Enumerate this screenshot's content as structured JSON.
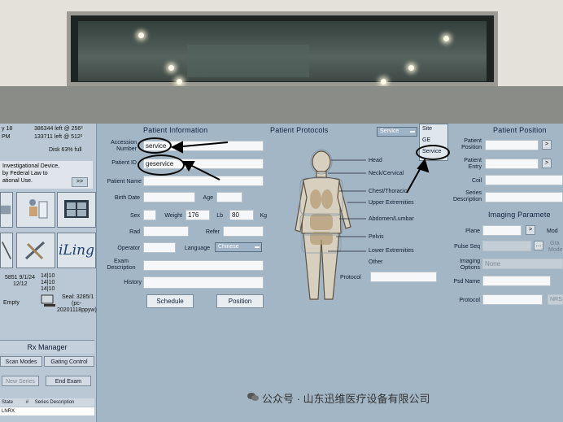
{
  "left_panel": {
    "top_lines": [
      {
        "left": "y 18",
        "right": "386344 left @ 256²"
      },
      {
        "left": "PM",
        "right": "133711 left @ 512²"
      }
    ],
    "disk": "Disk  63% full",
    "investigational": [
      "Investigational Device,",
      "by Federal Law to",
      "ational Use."
    ],
    "inv_button": ">>",
    "tile_caption_left": [
      "5851 9/1/24",
      "12/12"
    ],
    "tile_caption_mid": [
      "14|10",
      "14|10",
      "14|10"
    ],
    "empty_label": "Empty",
    "seal": [
      "Seal: 3285/1",
      "(pc-",
      "20201118ppyw)"
    ],
    "iling": "iLing",
    "rx_manager": "Rx Manager",
    "scan_modes": "Scan Modes",
    "gating_control": "Gating Control",
    "new_series": "New Series",
    "end_exam": "End Exam",
    "table_headers": [
      "State",
      "#",
      "Series Description"
    ],
    "row_1": "LNRX"
  },
  "patient_info": {
    "title": "Patient  Information",
    "accession_label": "Accession\nNumber",
    "accession_value": "service",
    "patient_id_label": "Patient ID",
    "patient_id_value": "geservice",
    "patient_name_label": "Patient Name",
    "birth_date_label": "Birth Date",
    "age_label": "Age",
    "sex_label": "Sex",
    "weight_label": "Weight",
    "weight_lb": "176",
    "lb_label": "Lb",
    "weight_kg": "80",
    "kg_label": "Kg",
    "rad_label": "Rad",
    "refer_label": "Refer",
    "operator_label": "Operator",
    "language_label": "Language",
    "language_value": "Chinese",
    "exam_desc_label": "Exam\nDescription",
    "history_label": "History",
    "schedule_button": "Schedule",
    "position_button": "Position"
  },
  "protocols": {
    "title": "Patient  Protocols",
    "selected": "Service",
    "menu": [
      "Site",
      "GE",
      "Service"
    ],
    "body_parts": [
      "Head",
      "Neck/Cervical",
      "Chest/Thoracic",
      "Upper Extremities",
      "Abdomen/Lumbar",
      "Pelvis",
      "Lower Extremities",
      "Other"
    ],
    "protocol_label": "Protocol"
  },
  "position": {
    "title": "Patient  Position",
    "patient_position_label": "Patient\nPosition",
    "patient_entry_label": "Patient\nEntry",
    "coil_label": "Coil",
    "series_desc_label": "Series\nDescription"
  },
  "imaging": {
    "title": "Imaging  Paramete",
    "plane_label": "Plane",
    "mode_label": "Mod",
    "pulse_seq_label": "Pulse Seq",
    "gra_label": "Gra",
    "mode2_label": "Mode",
    "imaging_options_label": "Imaging\nOptions",
    "imaging_options_value": "None",
    "psd_name_label": "Psd Name",
    "protocol_label": "Protocol",
    "nrs_label": "NRS"
  },
  "watermark": "公众号 · 山东迅维医疗设备有限公司"
}
